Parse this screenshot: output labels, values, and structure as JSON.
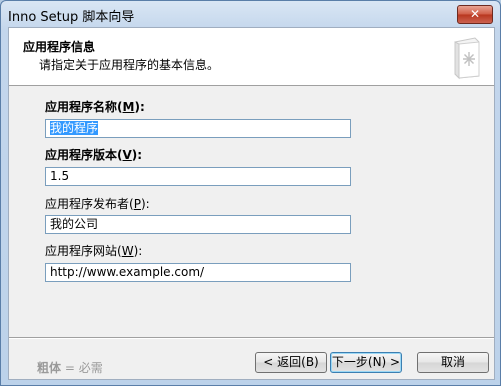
{
  "window": {
    "title": "Inno Setup 脚本向导",
    "close_glyph": "✕"
  },
  "header": {
    "title": "应用程序信息",
    "subtitle": "请指定关于应用程序的基本信息。",
    "icon": "book-star-icon"
  },
  "fields": [
    {
      "label": "应用程序名称(",
      "hotkey": "M",
      "label_end": "):",
      "required": true,
      "value": "我的程序",
      "selected": true
    },
    {
      "label": "应用程序版本(",
      "hotkey": "V",
      "label_end": "):",
      "required": true,
      "value": "1.5",
      "selected": false
    },
    {
      "label": "应用程序发布者(",
      "hotkey": "P",
      "label_end": "):",
      "required": false,
      "value": "我的公司",
      "selected": false
    },
    {
      "label": "应用程序网站(",
      "hotkey": "W",
      "label_end": "):",
      "required": false,
      "value": "http://www.example.com/",
      "selected": false
    }
  ],
  "footer": {
    "note_bold": "粗体",
    "note_rest": " = 必需",
    "back": "< 返回(B)",
    "next": "下一步(N) >",
    "cancel": "取消"
  }
}
